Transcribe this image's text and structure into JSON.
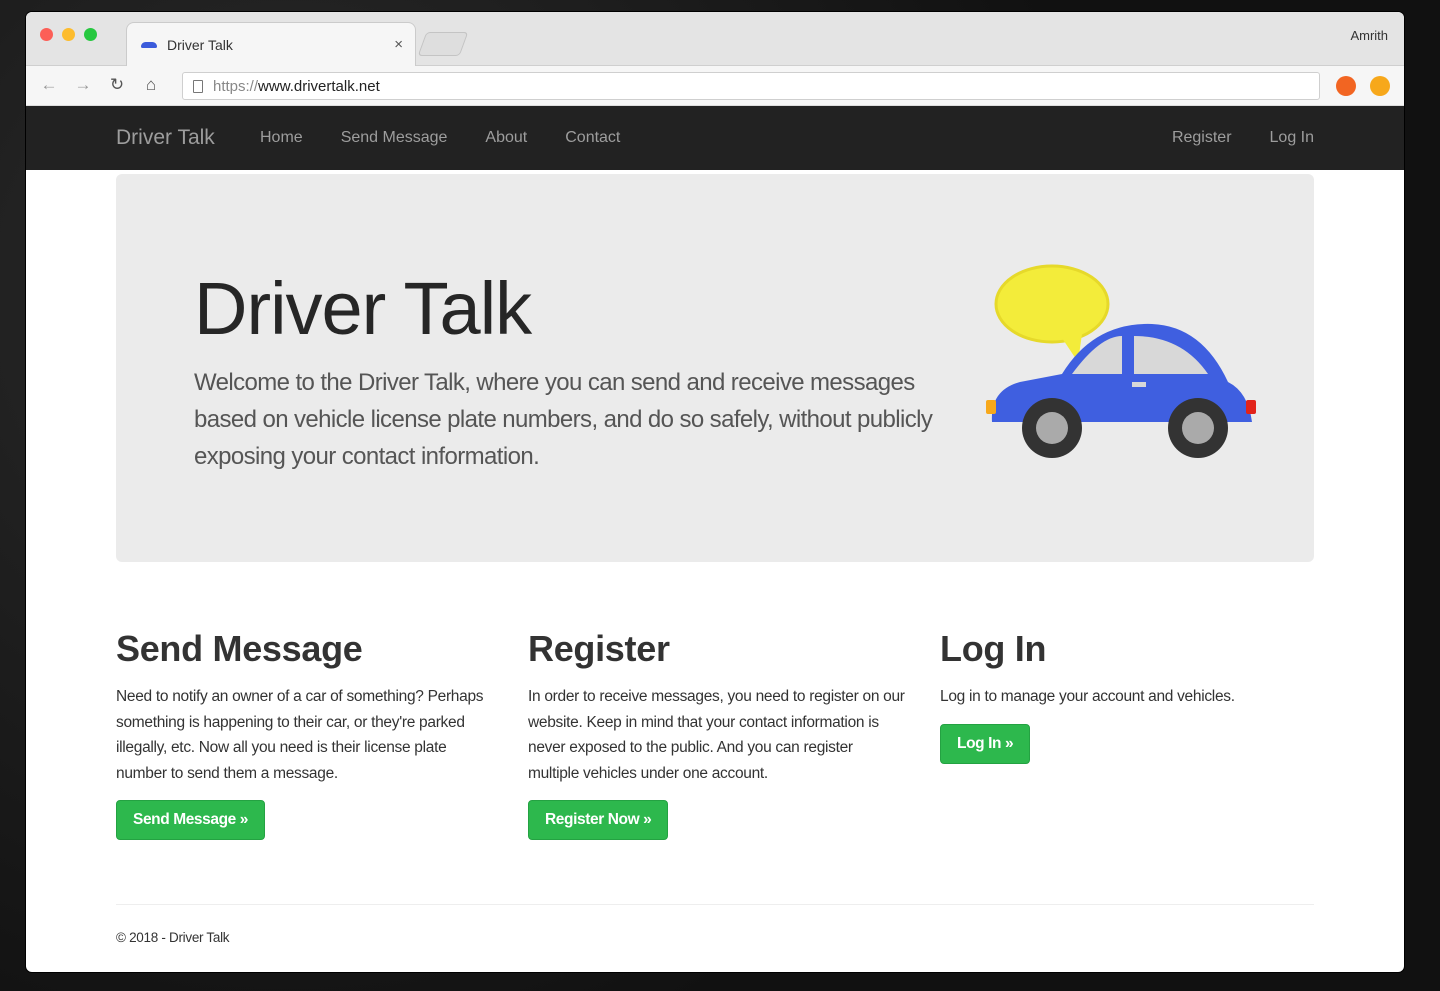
{
  "browser": {
    "tab_title": "Driver Talk",
    "tab_close": "×",
    "profile_name": "Amrith",
    "url_scheme": "https://",
    "url_host": "www.drivertalk.net",
    "icons": [
      "back-arrow-icon",
      "forward-arrow-icon",
      "reload-icon",
      "home-icon"
    ]
  },
  "navbar": {
    "brand": "Driver Talk",
    "links": [
      "Home",
      "Send Message",
      "About",
      "Contact"
    ],
    "right_links": [
      "Register",
      "Log In"
    ]
  },
  "jumbotron": {
    "title": "Driver Talk",
    "text": "Welcome to the Driver Talk, where you can send and receive messages based on vehicle license plate numbers, and do so safely, without publicly exposing your contact information."
  },
  "columns": [
    {
      "heading": "Send Message",
      "text": "Need to notify an owner of a car of something? Perhaps something is happening to their car, or they're parked illegally, etc. Now all you need is their license plate number to send them a message.",
      "button": "Send Message »"
    },
    {
      "heading": "Register",
      "text": "In order to receive messages, you need to register on our website. Keep in mind that your contact information is never exposed to the public. And you can register multiple vehicles under one account.",
      "button": "Register Now »"
    },
    {
      "heading": "Log In",
      "text": "Log in to manage your account and vehicles.",
      "button": "Log In »"
    }
  ],
  "footer": {
    "text": "© 2018 - Driver Talk"
  },
  "colors": {
    "navbar_bg": "#222222",
    "jumbotron_bg": "#ebebeb",
    "button_green": "#2db84d",
    "car_blue": "#3f5fe0",
    "bubble_yellow": "#f3ec3a"
  }
}
